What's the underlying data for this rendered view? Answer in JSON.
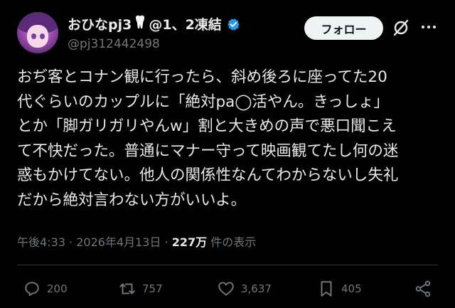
{
  "user": {
    "display_name": "おひなpj3",
    "name_suffix": "@1、2凍結",
    "handle": "@pj312442498",
    "verified_color": "#1d9bf0"
  },
  "follow_button": {
    "label": "フォロー"
  },
  "icons": {
    "avatar": "avatar-image",
    "tooth": "tooth-emoji",
    "verified": "verified-badge-icon",
    "grok": "grok-icon",
    "more": "more-dots-icon"
  },
  "tweet": {
    "text": "おぢ客とコナン観に行ったら、斜め後ろに座ってた20\n代ぐらいのカップルに「絶対pa◯活やん。きっしょ」\nとか「脚ガリガリやんw」割と大きめの声で悪口聞こえ\nて不快だった。普通にマナー守って映画観てたし何の迷\n惑もかけてない。他人の関係性なんてわからないし失礼\nだから絶対言わない方がいいよ。"
  },
  "meta": {
    "time": "午後4:33",
    "date": "2026年4月13日",
    "views": "227万",
    "views_label": "件の表示"
  },
  "actions": {
    "replies": "200",
    "reposts": "757",
    "likes": "3,637",
    "bookmarks": "405"
  }
}
